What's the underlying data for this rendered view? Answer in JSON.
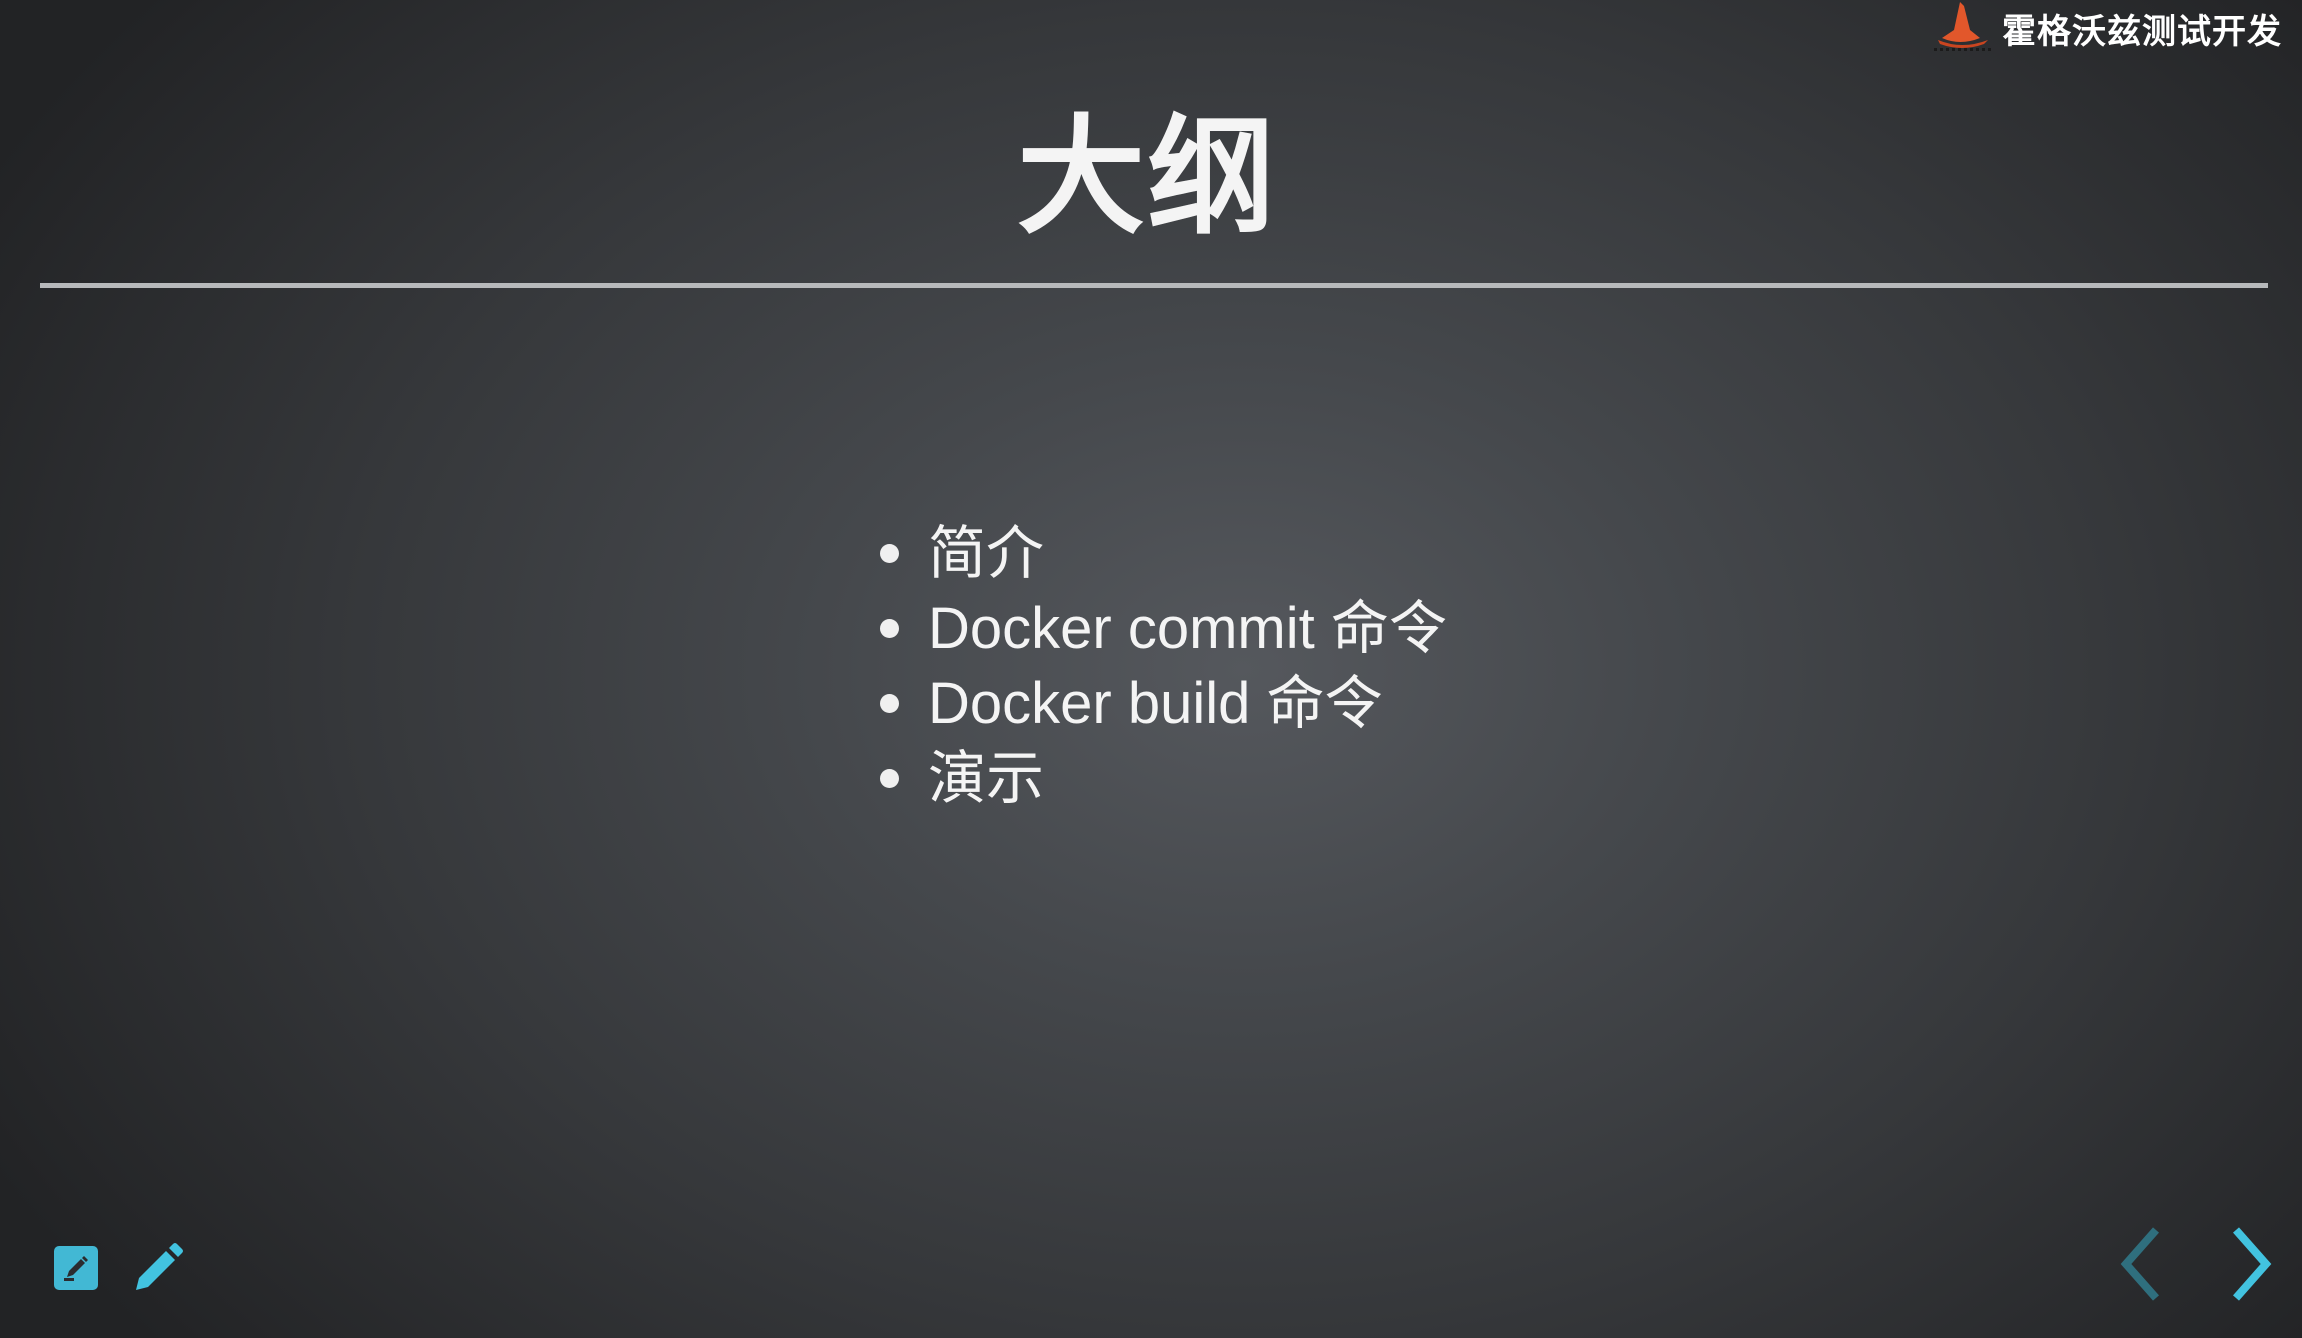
{
  "brand": {
    "name": "霍格沃兹测试开发",
    "mark_icon": "witch-hat-logo",
    "mark_color": "#e2572b"
  },
  "slide": {
    "title": "大纲",
    "items": [
      {
        "label": "简介"
      },
      {
        "label": "Docker commit 命令"
      },
      {
        "label": "Docker build 命令"
      },
      {
        "label": "演示"
      }
    ]
  },
  "toolbar": {
    "notes_icon": "notes-icon",
    "pen_icon": "pencil-icon",
    "accent_color": "#42b8d4"
  },
  "navigation": {
    "prev_icon": "chevron-left-icon",
    "next_icon": "chevron-right-icon",
    "prev_enabled": false,
    "next_enabled": true,
    "active_color": "#42c3e0",
    "disabled_color": "#2f6f7e"
  }
}
